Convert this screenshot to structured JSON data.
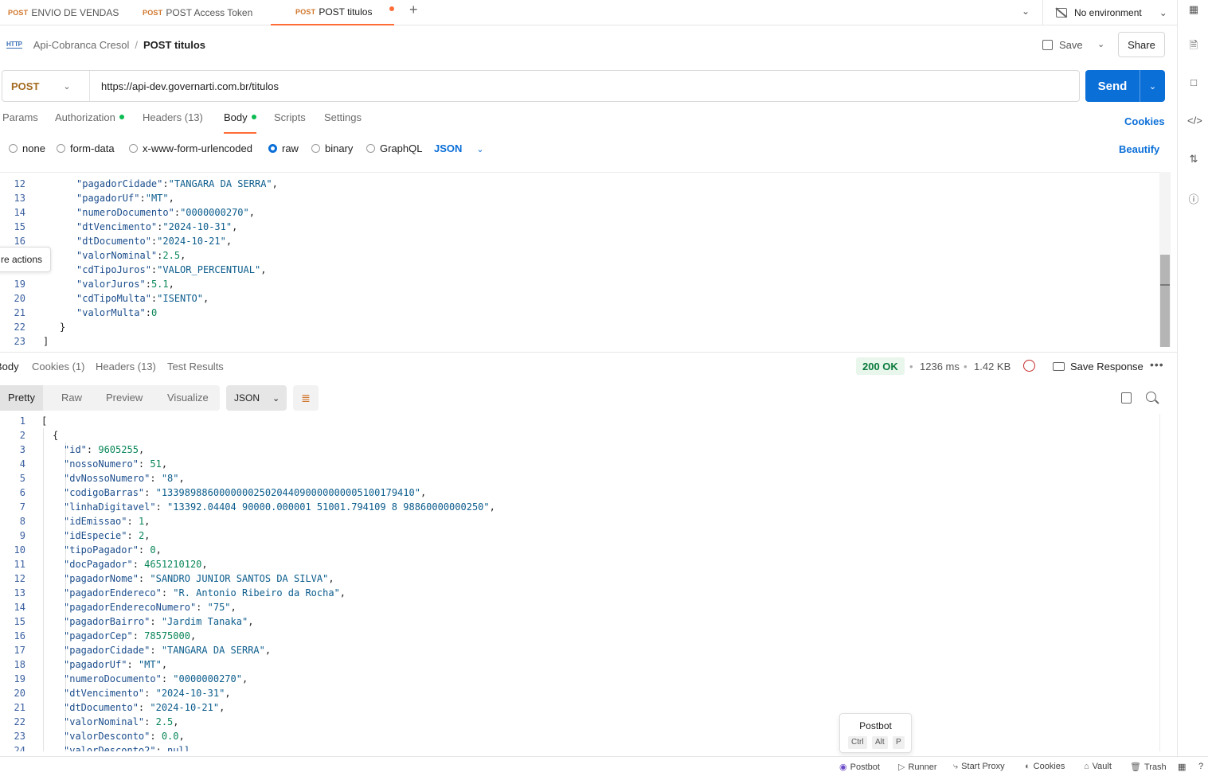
{
  "tabs": [
    {
      "method": "POST",
      "label": "ENVIO DE VENDAS"
    },
    {
      "method": "POST",
      "label": "POST Access Token"
    },
    {
      "method": "POST",
      "label": "POST titulos"
    }
  ],
  "environment": "No environment",
  "breadcrumb": {
    "collection": "Api-Cobranca Cresol",
    "separator": "/",
    "request": "POST titulos",
    "icon": "HTTP"
  },
  "actions": {
    "save": "Save",
    "share": "Share"
  },
  "request": {
    "method": "POST",
    "url": "https://api-dev.governarti.com.br/titulos",
    "send": "Send"
  },
  "request_tabs": [
    "Params",
    "Authorization",
    "Headers (13)",
    "Body",
    "Scripts",
    "Settings"
  ],
  "cookies_link": "Cookies",
  "body_types": [
    "none",
    "form-data",
    "x-www-form-urlencoded",
    "raw",
    "binary",
    "GraphQL"
  ],
  "body_format": "JSON",
  "beautify": "Beautify",
  "tooltip": "re actions",
  "request_body": [
    {
      "n": "12",
      "indent": 4,
      "key": "\"pagadorCidade\"",
      "sep": ":",
      "val": "\"TANGARA DA SERRA\"",
      "vt": "s",
      "tail": ","
    },
    {
      "n": "13",
      "indent": 4,
      "key": "\"pagadorUf\"",
      "sep": ":",
      "val": "\"MT\"",
      "vt": "s",
      "tail": ","
    },
    {
      "n": "14",
      "indent": 4,
      "key": "\"numeroDocumento\"",
      "sep": ":",
      "val": "\"0000000270\"",
      "vt": "s",
      "tail": ","
    },
    {
      "n": "15",
      "indent": 4,
      "key": "\"dtVencimento\"",
      "sep": ":",
      "val": "\"2024-10-31\"",
      "vt": "s",
      "tail": ","
    },
    {
      "n": "16",
      "indent": 4,
      "key": "\"dtDocumento\"",
      "sep": ":",
      "val": "\"2024-10-21\"",
      "vt": "s",
      "tail": ","
    },
    {
      "n": "",
      "indent": 4,
      "key": "\"valorNominal\"",
      "sep": ":",
      "val": "2.5",
      "vt": "n",
      "tail": ","
    },
    {
      "n": "",
      "indent": 4,
      "key": "\"cdTipoJuros\"",
      "sep": ":",
      "val": "\"VALOR_PERCENTUAL\"",
      "vt": "s",
      "tail": ","
    },
    {
      "n": "19",
      "indent": 4,
      "key": "\"valorJuros\"",
      "sep": ":",
      "val": "5.1",
      "vt": "n",
      "tail": ","
    },
    {
      "n": "20",
      "indent": 4,
      "key": "\"cdTipoMulta\"",
      "sep": ":",
      "val": "\"ISENTO\"",
      "vt": "s",
      "tail": ","
    },
    {
      "n": "21",
      "indent": 4,
      "key": "\"valorMulta\"",
      "sep": ":",
      "val": "0",
      "vt": "n",
      "tail": ""
    },
    {
      "n": "22",
      "indent": 2,
      "key": "}",
      "sep": "",
      "val": "",
      "vt": "",
      "tail": ""
    },
    {
      "n": "23",
      "indent": 0,
      "key": "]",
      "sep": "",
      "val": "",
      "vt": "",
      "tail": ""
    }
  ],
  "response_tabs": [
    "Body",
    "Cookies (1)",
    "Headers (13)",
    "Test Results"
  ],
  "response_meta": {
    "status": "200 OK",
    "time": "1236 ms",
    "size": "1.42 KB",
    "save_response": "Save Response"
  },
  "view_modes": [
    "Pretty",
    "Raw",
    "Preview",
    "Visualize"
  ],
  "response_format": "JSON",
  "response_body": [
    {
      "n": "1",
      "indent": 0,
      "key": "[",
      "sep": "",
      "val": "",
      "vt": "",
      "tail": ""
    },
    {
      "n": "2",
      "indent": 1,
      "key": "{",
      "sep": "",
      "val": "",
      "vt": "",
      "tail": ""
    },
    {
      "n": "3",
      "indent": 2,
      "key": "\"id\"",
      "sep": ": ",
      "val": "9605255",
      "vt": "n",
      "tail": ","
    },
    {
      "n": "4",
      "indent": 2,
      "key": "\"nossoNumero\"",
      "sep": ": ",
      "val": "51",
      "vt": "n",
      "tail": ","
    },
    {
      "n": "5",
      "indent": 2,
      "key": "\"dvNossoNumero\"",
      "sep": ": ",
      "val": "\"8\"",
      "vt": "s",
      "tail": ","
    },
    {
      "n": "6",
      "indent": 2,
      "key": "\"codigoBarras\"",
      "sep": ": ",
      "val": "\"13398988600000002502044090000000005100179410\"",
      "vt": "s",
      "tail": ","
    },
    {
      "n": "7",
      "indent": 2,
      "key": "\"linhaDigitavel\"",
      "sep": ": ",
      "val": "\"13392.04404 90000.000001 51001.794109 8 98860000000250\"",
      "vt": "s",
      "tail": ","
    },
    {
      "n": "8",
      "indent": 2,
      "key": "\"idEmissao\"",
      "sep": ": ",
      "val": "1",
      "vt": "n",
      "tail": ","
    },
    {
      "n": "9",
      "indent": 2,
      "key": "\"idEspecie\"",
      "sep": ": ",
      "val": "2",
      "vt": "n",
      "tail": ","
    },
    {
      "n": "10",
      "indent": 2,
      "key": "\"tipoPagador\"",
      "sep": ": ",
      "val": "0",
      "vt": "n",
      "tail": ","
    },
    {
      "n": "11",
      "indent": 2,
      "key": "\"docPagador\"",
      "sep": ": ",
      "val": "4651210120",
      "vt": "n",
      "tail": ","
    },
    {
      "n": "12",
      "indent": 2,
      "key": "\"pagadorNome\"",
      "sep": ": ",
      "val": "\"SANDRO JUNIOR SANTOS DA SILVA\"",
      "vt": "s",
      "tail": ","
    },
    {
      "n": "13",
      "indent": 2,
      "key": "\"pagadorEndereco\"",
      "sep": ": ",
      "val": "\"R. Antonio Ribeiro da Rocha\"",
      "vt": "s",
      "tail": ","
    },
    {
      "n": "14",
      "indent": 2,
      "key": "\"pagadorEnderecoNumero\"",
      "sep": ": ",
      "val": "\"75\"",
      "vt": "s",
      "tail": ","
    },
    {
      "n": "15",
      "indent": 2,
      "key": "\"pagadorBairro\"",
      "sep": ": ",
      "val": "\"Jardim Tanaka\"",
      "vt": "s",
      "tail": ","
    },
    {
      "n": "16",
      "indent": 2,
      "key": "\"pagadorCep\"",
      "sep": ": ",
      "val": "78575000",
      "vt": "n",
      "tail": ","
    },
    {
      "n": "17",
      "indent": 2,
      "key": "\"pagadorCidade\"",
      "sep": ": ",
      "val": "\"TANGARA DA SERRA\"",
      "vt": "s",
      "tail": ","
    },
    {
      "n": "18",
      "indent": 2,
      "key": "\"pagadorUf\"",
      "sep": ": ",
      "val": "\"MT\"",
      "vt": "s",
      "tail": ","
    },
    {
      "n": "19",
      "indent": 2,
      "key": "\"numeroDocumento\"",
      "sep": ": ",
      "val": "\"0000000270\"",
      "vt": "s",
      "tail": ","
    },
    {
      "n": "20",
      "indent": 2,
      "key": "\"dtVencimento\"",
      "sep": ": ",
      "val": "\"2024-10-31\"",
      "vt": "s",
      "tail": ","
    },
    {
      "n": "21",
      "indent": 2,
      "key": "\"dtDocumento\"",
      "sep": ": ",
      "val": "\"2024-10-21\"",
      "vt": "s",
      "tail": ","
    },
    {
      "n": "22",
      "indent": 2,
      "key": "\"valorNominal\"",
      "sep": ": ",
      "val": "2.5",
      "vt": "n",
      "tail": ","
    },
    {
      "n": "23",
      "indent": 2,
      "key": "\"valorDesconto\"",
      "sep": ": ",
      "val": "0.0",
      "vt": "n",
      "tail": ","
    },
    {
      "n": "24",
      "indent": 2,
      "key": "\"valorDesconto2\"",
      "sep": ": ",
      "val": "null",
      "vt": "k",
      "tail": ""
    }
  ],
  "postbot_popup": {
    "title": "Postbot",
    "keys": [
      "Ctrl",
      "Alt",
      "P"
    ]
  },
  "statusbar": [
    "Postbot",
    "Runner",
    "Start Proxy",
    "Cookies",
    "Vault",
    "Trash"
  ],
  "colors": {
    "accent": "#ff6c37",
    "send": "#0b6fd8",
    "status_ok": "#0a7a3b"
  }
}
